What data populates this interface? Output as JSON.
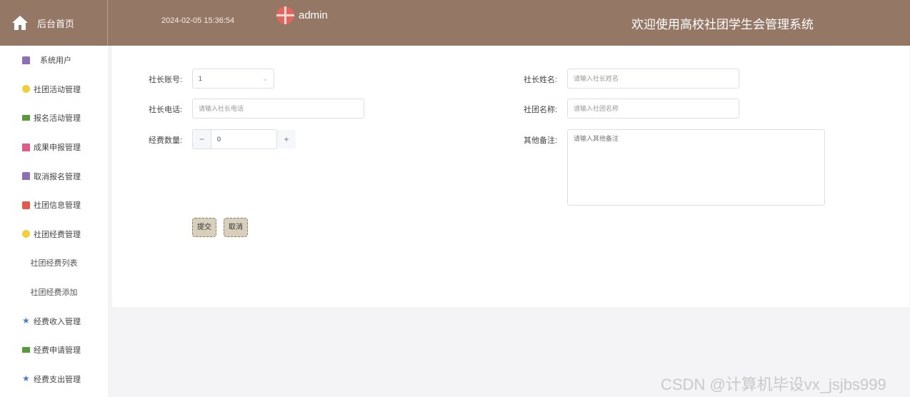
{
  "header": {
    "home_label": "后台首页",
    "datetime": "2024-02-05 15:36:54",
    "username": "admin",
    "system_title": "欢迎使用高校社团学生会管理系统"
  },
  "sidebar": {
    "items": [
      {
        "label": "系统用户",
        "icon": "user-group-icon",
        "color": "#8e6fb5"
      },
      {
        "label": "社团活动管理",
        "icon": "smile-icon",
        "color": "#f0d03a"
      },
      {
        "label": "报名活动管理",
        "icon": "message-icon",
        "color": "#5a9a3a"
      },
      {
        "label": "成果申报管理",
        "icon": "document-icon",
        "color": "#e05a8a"
      },
      {
        "label": "取消报名管理",
        "icon": "user-group-icon",
        "color": "#8e6fb5"
      },
      {
        "label": "社团信息管理",
        "icon": "grid-icon",
        "color": "#e05a4a"
      },
      {
        "label": "社团经费管理",
        "icon": "smile-icon",
        "color": "#f0d03a"
      },
      {
        "label": "社团经费列表",
        "icon": "",
        "color": ""
      },
      {
        "label": "社团经费添加",
        "icon": "",
        "color": ""
      },
      {
        "label": "经费收入管理",
        "icon": "star-icon",
        "color": "#4a7ecc"
      },
      {
        "label": "经费申请管理",
        "icon": "message-icon",
        "color": "#5a9a3a"
      },
      {
        "label": "经费支出管理",
        "icon": "star-icon",
        "color": "#4a7ecc"
      }
    ]
  },
  "form": {
    "leader_account_label": "社长账号:",
    "leader_account_value": "1",
    "leader_phone_label": "社长电话:",
    "leader_phone_placeholder": "请输入社长电话",
    "funds_label": "经费数量:",
    "funds_value": "0",
    "minus_symbol": "−",
    "plus_symbol": "+",
    "leader_name_label": "社长姓名:",
    "leader_name_placeholder": "请输入社长姓名",
    "club_name_label": "社团名称:",
    "club_name_placeholder": "请输入社团名称",
    "remarks_label": "其他备注:",
    "remarks_placeholder": "请输入其他备注",
    "submit_label": "提交",
    "cancel_label": "取消"
  },
  "watermark": "CSDN @计算机毕设vx_jsjbs999"
}
